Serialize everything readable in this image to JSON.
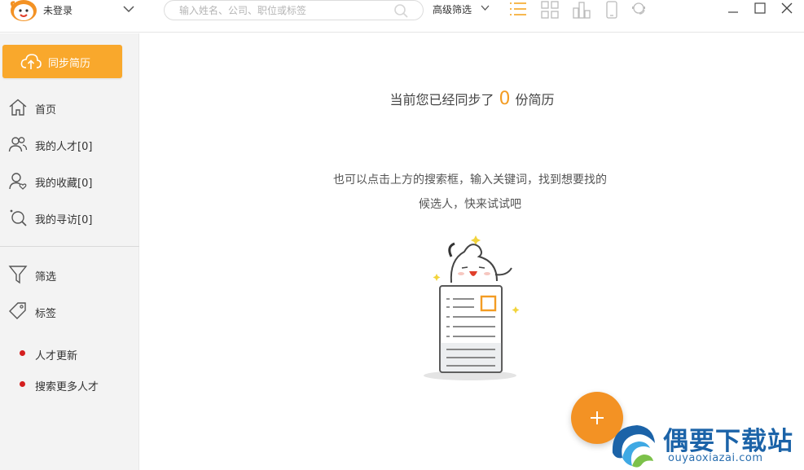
{
  "header": {
    "user_label": "未登录",
    "search_placeholder": "输入姓名、公司、职位或标签",
    "advanced_filter_label": "高级筛选",
    "icons": [
      "list-view-icon",
      "grid-view-icon",
      "org-chart-icon",
      "mobile-icon",
      "support-icon"
    ],
    "window_controls": [
      "minimize",
      "maximize",
      "close"
    ]
  },
  "sidebar": {
    "sync_button_label": "同步简历",
    "nav": [
      {
        "label": "首页",
        "icon": "home-icon"
      },
      {
        "label": "我的人才[0]",
        "icon": "people-icon"
      },
      {
        "label": "我的收藏[0]",
        "icon": "favorite-user-icon"
      },
      {
        "label": "我的寻访[0]",
        "icon": "search-visit-icon"
      }
    ],
    "tools": [
      {
        "label": "筛选",
        "icon": "filter-icon"
      },
      {
        "label": "标签",
        "icon": "tag-icon"
      }
    ],
    "links": [
      {
        "label": "人才更新"
      },
      {
        "label": "搜索更多人才"
      }
    ]
  },
  "main": {
    "sync_prefix": "当前您已经同步了",
    "sync_count": "0",
    "sync_suffix": "份简历",
    "hint_line1": "也可以点击上方的搜索框，输入关键词，找到想要找的",
    "hint_line2": "候选人，快来试试吧"
  },
  "watermark": {
    "name_cn": "偶要下载站",
    "domain": "ouyaoxiazai.com"
  },
  "colors": {
    "accent": "#f9a82c",
    "count": "#f39c23",
    "fab": "#f39224",
    "dot": "#d41e1e",
    "watermark": "#1b63a8"
  }
}
